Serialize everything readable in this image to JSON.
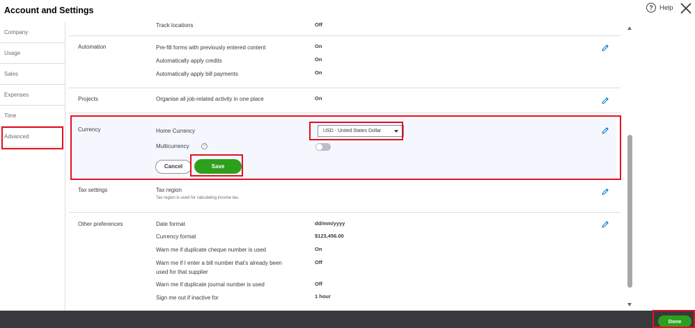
{
  "header": {
    "title": "Account and Settings",
    "help_label": "Help",
    "help_glyph": "?"
  },
  "sidebar": {
    "items": [
      {
        "label": "Company"
      },
      {
        "label": "Usage"
      },
      {
        "label": "Sales"
      },
      {
        "label": "Expenses"
      },
      {
        "label": "Time"
      },
      {
        "label": "Advanced",
        "selected": true
      }
    ]
  },
  "sections": {
    "time_tracking": {
      "label": "Track locations",
      "value": "Off"
    },
    "automation": {
      "title": "Automation",
      "rows": [
        {
          "label": "Pre-fill forms with previously entered content",
          "value": "On"
        },
        {
          "label": "Automatically apply credits",
          "value": "On"
        },
        {
          "label": "Automatically apply bill payments",
          "value": "On"
        }
      ]
    },
    "projects": {
      "title": "Projects",
      "rows": [
        {
          "label": "Organise all job-related activity in one place",
          "value": "On"
        }
      ]
    },
    "currency": {
      "title": "Currency",
      "home_currency_label": "Home Currency",
      "home_currency_value": "USD - United States Dollar",
      "multicurrency_label": "Multicurrency",
      "multicurrency_on": false,
      "info_glyph": "?",
      "cancel_label": "Cancel",
      "save_label": "Save"
    },
    "tax": {
      "title": "Tax settings",
      "label": "Tax region",
      "note": "Tax region is used for calculating income tax."
    },
    "other": {
      "title": "Other preferences",
      "rows": [
        {
          "label": "Date format",
          "value": "dd/mm/yyyy"
        },
        {
          "label": "Currency format",
          "value": "$123,456.00"
        },
        {
          "label": "Warn me if duplicate cheque number is used",
          "value": "On"
        },
        {
          "label_line1": "Warn me if I enter a bill number that's already been",
          "label_line2": "used for that supplier",
          "value": "Off"
        },
        {
          "label": "Warn me if duplicate journal number is used",
          "value": "Off"
        },
        {
          "label": "Sign me out if inactive for",
          "value": "1 hour"
        }
      ]
    }
  },
  "footer": {
    "done_label": "Done"
  },
  "colors": {
    "accent_green": "#2ca01c",
    "highlight_red": "#e3101f",
    "edit_icon_blue": "#0077c5",
    "footer_bg": "#393a3d"
  }
}
